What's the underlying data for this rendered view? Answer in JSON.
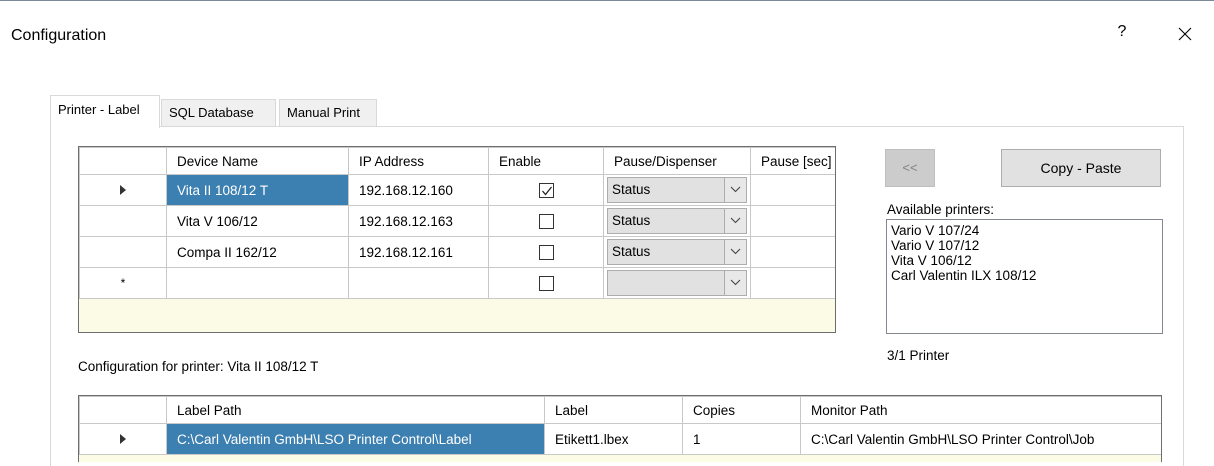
{
  "window": {
    "title": "Configuration",
    "help_label": "?"
  },
  "tabs": [
    {
      "label": "Printer - Label",
      "active": true
    },
    {
      "label": "SQL Database",
      "active": false
    },
    {
      "label": "Manual Print",
      "active": false
    }
  ],
  "printer_grid": {
    "columns": [
      "Device Name",
      "IP Address",
      "Enable",
      "Pause/Dispenser",
      "Pause [sec]"
    ],
    "rows": [
      {
        "device": "Vita II 108/12 T",
        "ip": "192.168.12.160",
        "enabled": true,
        "pause_dispenser": "Status",
        "pause_sec": "",
        "selected": true
      },
      {
        "device": "Vita V 106/12",
        "ip": "192.168.12.163",
        "enabled": false,
        "pause_dispenser": "Status",
        "pause_sec": ""
      },
      {
        "device": "Compa II 162/12",
        "ip": "192.168.12.161",
        "enabled": false,
        "pause_dispenser": "Status",
        "pause_sec": ""
      }
    ],
    "new_row_marker": "*"
  },
  "buttons": {
    "back_label": "<<",
    "copy_paste_label": "Copy - Paste"
  },
  "available_printers": {
    "label": "Available printers:",
    "items": [
      "Vario V 107/24",
      "Vario V 107/12",
      "Vita V 106/12",
      "Carl Valentin ILX 108/12"
    ]
  },
  "printer_count": "3/1 Printer",
  "config_for_printer": "Configuration for printer: Vita II 108/12 T",
  "label_grid": {
    "columns": [
      "Label Path",
      "Label",
      "Copies",
      "Monitor Path"
    ],
    "rows": [
      {
        "label_path": "C:\\Carl Valentin GmbH\\LSO Printer Control\\Label",
        "label": "Etikett1.lbex",
        "copies": "1",
        "monitor_path": "C:\\Carl Valentin GmbH\\LSO Printer Control\\Job"
      }
    ]
  },
  "colors": {
    "selection": "#3c7fb1",
    "grid_background": "#fcfce6"
  }
}
